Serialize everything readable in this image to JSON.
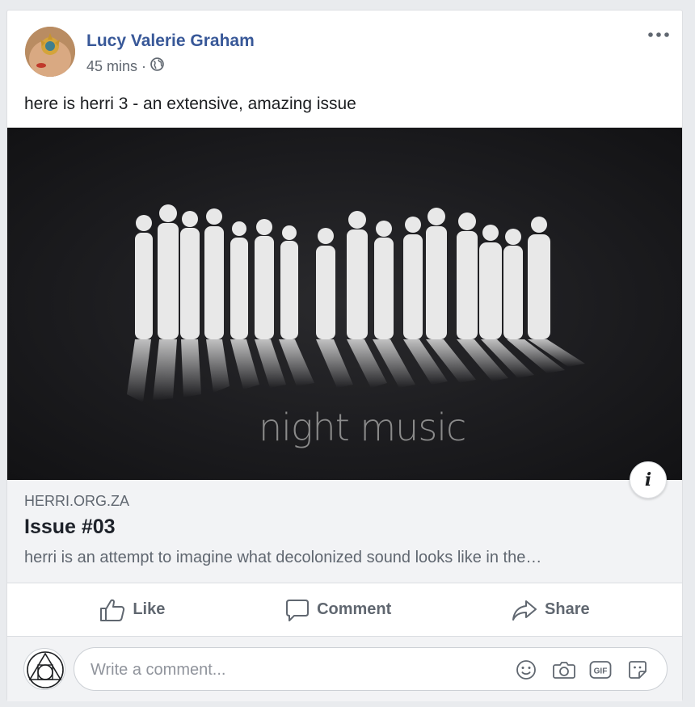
{
  "post": {
    "author": "Lucy Valerie Graham",
    "time": "45 mins",
    "separator": "·",
    "audience_icon": "globe-icon",
    "more_icon": "more-options-icon",
    "text": "here is herri 3 - an extensive, amazing issue"
  },
  "link_preview": {
    "image_caption": "night music",
    "domain": "HERRI.ORG.ZA",
    "title": "Issue #03",
    "description": "herri is an attempt to imagine what decolonized sound looks like in the…",
    "info_label": "i"
  },
  "actions": {
    "like": "Like",
    "comment": "Comment",
    "share": "Share"
  },
  "composer": {
    "placeholder": "Write a comment...",
    "icons": [
      "emoji-icon",
      "camera-icon",
      "gif-icon",
      "sticker-icon"
    ]
  },
  "colors": {
    "author_link": "#385898",
    "secondary_text": "#606770",
    "card_bg": "#ffffff",
    "page_bg": "#e9ebee"
  }
}
